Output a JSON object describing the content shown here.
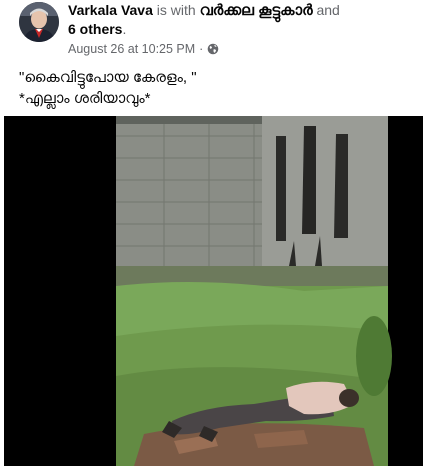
{
  "post": {
    "author": "Varkala Vava",
    "is_with": "is with",
    "group": "വർക്കല കൂട്ടുകാർ",
    "and": "and",
    "others": "6 others",
    "period": ".",
    "timestamp": "August 26 at 10:25 PM",
    "dot": "·",
    "privacy_icon": "globe-icon",
    "text": "\"കൈവിട്ടുപോയ കേരളം, \"\n*എല്ലാം ശരിയാവും*"
  },
  "video": {
    "description_icon": "video-player",
    "colors": {
      "wall": "#8a8d86",
      "grass": "#6f9a4d",
      "side": "#000000"
    }
  }
}
